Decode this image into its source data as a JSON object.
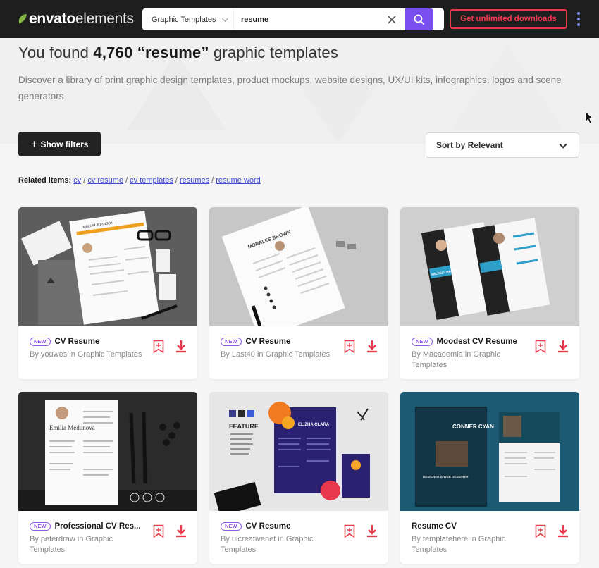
{
  "brand": {
    "logo_bold": "envato",
    "logo_light": "elements"
  },
  "search": {
    "category": "Graphic Templates",
    "query": "resume"
  },
  "header": {
    "cta_label": "Get unlimited downloads"
  },
  "hero": {
    "headline_prefix": "You found",
    "headline_count": "4,760",
    "headline_query": "“resume”",
    "headline_suffix": "graphic templates",
    "description": "Discover a library of print graphic design templates, product mockups, website designs, UX/UI kits, infographics, logos and scene generators"
  },
  "controls": {
    "filters_label": "Show filters",
    "sort_label": "Sort by Relevant"
  },
  "related": {
    "label": "Related items:",
    "links": [
      "cv",
      "cv resume",
      "cv templates",
      "resumes",
      "resume word"
    ]
  },
  "cards": [
    {
      "title": "CV Resume",
      "badge": "NEW",
      "byline": "By youwes in Graphic Templates"
    },
    {
      "title": "CV Resume",
      "badge": "NEW",
      "byline": "By Last40 in Graphic Templates"
    },
    {
      "title": "Moodest CV Resume",
      "badge": "NEW",
      "byline": "By Macademia in Graphic Templates"
    },
    {
      "title": "Professional CV Res...",
      "badge": "NEW",
      "byline": "By peterdraw in Graphic Templates"
    },
    {
      "title": "CV Resume",
      "badge": "NEW",
      "byline": "By uicreativenet in Graphic Templates"
    },
    {
      "title": "Resume CV",
      "badge": "",
      "byline": "By templatehere in Graphic Templates"
    }
  ],
  "thumb_text": {
    "card0_name": "MALUM JOHNSON",
    "card1_name": "MORALES BROWN",
    "card2_name": "MICHELL HAGUE",
    "card3_name": "Emilia Medunová",
    "card4_feature": "FEATURE",
    "card4_name": "ELIZHA CLARA",
    "card5_name": "CONNER CYAN",
    "card5_role": "DESIGNER & WEB DESIGNER"
  },
  "colors": {
    "accent": "#e8394c",
    "purple": "#7a4ff0",
    "link": "#3b4bd6",
    "badge": "#8f5ae6"
  }
}
